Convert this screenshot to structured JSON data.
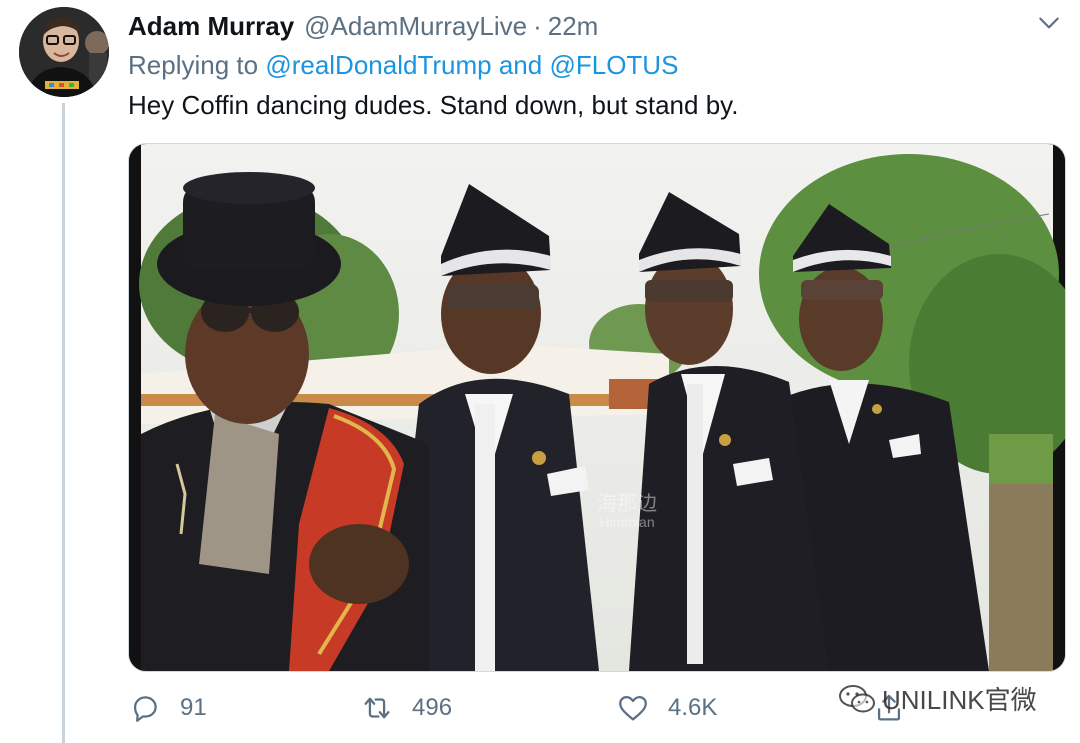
{
  "tweet": {
    "display_name": "Adam Murray",
    "handle": "@AdamMurrayLive",
    "separator": "·",
    "timestamp": "22m",
    "replying_to_prefix": "Replying to",
    "reply_mention_1": "@realDonaldTrump",
    "reply_conjunction": "and",
    "reply_mention_2": "@FLOTUS",
    "text": "Hey Coffin dancing dudes. Stand down, but stand by."
  },
  "media": {
    "watermark_line1": "海那边",
    "watermark_line2": "Hinabian"
  },
  "actions": {
    "reply_icon": "reply-icon",
    "reply_count": "91",
    "retweet_icon": "retweet-icon",
    "retweet_count": "496",
    "like_icon": "heart-icon",
    "like_count": "4.6K",
    "share_icon": "share-icon"
  },
  "overlay": {
    "brand_watermark": "UNILINK官微"
  },
  "colors": {
    "text": "#0f1419",
    "secondary": "#5b7083",
    "link": "#1b95e0",
    "thread_line": "#c9d3db"
  }
}
